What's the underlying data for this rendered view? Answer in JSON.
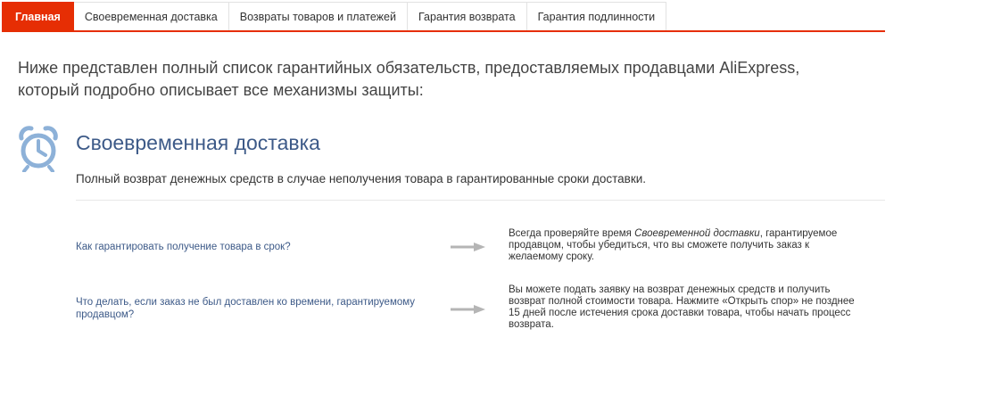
{
  "tabs": [
    {
      "label": "Главная",
      "active": true
    },
    {
      "label": "Своевременная доставка",
      "active": false
    },
    {
      "label": "Возвраты товаров и платежей",
      "active": false
    },
    {
      "label": "Гарантия возврата",
      "active": false
    },
    {
      "label": "Гарантия подлинности",
      "active": false
    }
  ],
  "intro": {
    "line1": "Ниже представлен полный список гарантийных обязательств, предоставляемых продавцами AliExpress,",
    "line2": "который подробно описывает все механизмы защиты:"
  },
  "section": {
    "icon": "alarm-clock-icon",
    "title": "Своевременная доставка",
    "description": "Полный возврат денежных средств в случае неполучения товара в гарантированные сроки доставки."
  },
  "faq": [
    {
      "question": "Как гарантировать получение товара в срок?",
      "answer_before": "Всегда проверяйте время ",
      "answer_em": "Своевременной доставки",
      "answer_after": ", гарантируемое продавцом, чтобы убедиться, что вы сможете получить заказ к желаемому сроку."
    },
    {
      "question": "Что делать, если заказ не был доставлен ко времени, гарантируемому продавцом?",
      "answer_before": "Вы можете подать заявку на возврат денежных средств и получить возврат полной стоимости товара. Нажмите «Открыть спор» не позднее 15 дней после истечения срока доставки товара, чтобы начать процесс возврата.",
      "answer_em": "",
      "answer_after": ""
    }
  ],
  "colors": {
    "accent": "#e62e04",
    "link": "#3d5a88",
    "icon": "#8db1d8",
    "arrow": "#b5b5b5"
  }
}
